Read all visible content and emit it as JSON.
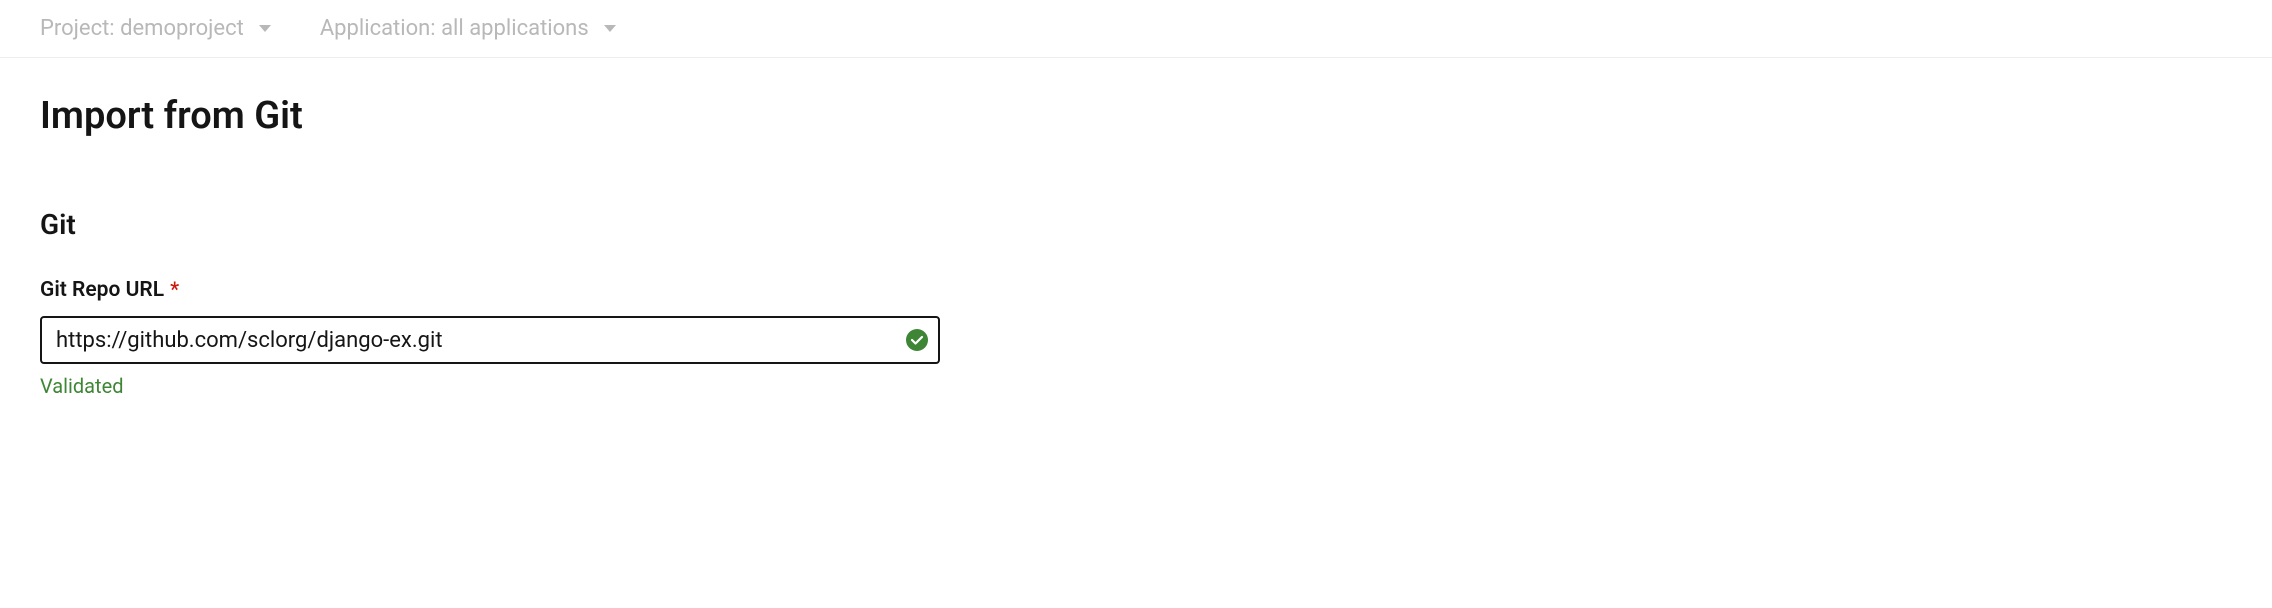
{
  "topbar": {
    "project": {
      "prefix": "Project:",
      "value": "demoproject"
    },
    "application": {
      "prefix": "Application:",
      "value": "all applications"
    }
  },
  "page": {
    "title": "Import from Git"
  },
  "section": {
    "git": {
      "title": "Git",
      "repo_url": {
        "label": "Git Repo URL",
        "required_marker": "*",
        "value": "https://github.com/sclorg/django-ex.git",
        "validation_status": "Validated"
      }
    }
  },
  "colors": {
    "success": "#3e8635",
    "required": "#c9190b",
    "muted": "#b8b8b8"
  }
}
